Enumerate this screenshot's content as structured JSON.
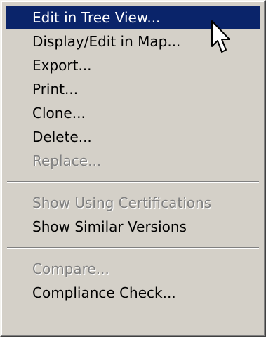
{
  "menu": {
    "groups": [
      {
        "items": [
          {
            "label": "Edit in Tree View...",
            "state": "highlighted"
          },
          {
            "label": "Display/Edit in Map...",
            "state": "enabled"
          },
          {
            "label": "Export...",
            "state": "enabled"
          },
          {
            "label": "Print...",
            "state": "enabled"
          },
          {
            "label": "Clone...",
            "state": "enabled"
          },
          {
            "label": "Delete...",
            "state": "enabled"
          },
          {
            "label": "Replace...",
            "state": "disabled"
          }
        ]
      },
      {
        "items": [
          {
            "label": "Show Using Certifications",
            "state": "disabled"
          },
          {
            "label": "Show Similar Versions",
            "state": "enabled"
          }
        ]
      },
      {
        "items": [
          {
            "label": "Compare...",
            "state": "disabled"
          },
          {
            "label": "Compliance Check...",
            "state": "enabled"
          }
        ]
      }
    ],
    "colors": {
      "background": "#d4d0c8",
      "highlight": "#0a246a",
      "disabled_text": "#808080"
    }
  },
  "cursor": {
    "icon": "arrow-cursor-icon"
  }
}
